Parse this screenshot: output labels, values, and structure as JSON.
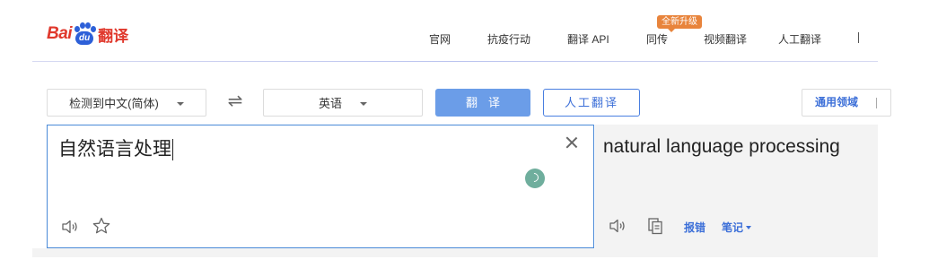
{
  "header": {
    "logo": {
      "bai": "Bai",
      "du": "du",
      "fanyi": "翻译"
    },
    "nav": [
      {
        "label": "官网"
      },
      {
        "label": "抗疫行动"
      },
      {
        "label": "翻译 API"
      },
      {
        "label": "同传"
      },
      {
        "label": "视频翻译"
      },
      {
        "label": "人工翻译"
      }
    ],
    "badge": "全新升级"
  },
  "toolbar": {
    "source_lang": "检测到中文(简体)",
    "target_lang": "英语",
    "translate_button": "翻译",
    "human_translate_button": "人工翻译",
    "domain_label": "通用领域"
  },
  "input": {
    "text": "自然语言处理"
  },
  "output": {
    "text": "natural language processing",
    "report_error": "报错",
    "notes": "笔记"
  },
  "colors": {
    "brand_red": "#e0382c",
    "brand_blue": "#2d60d8",
    "accent_blue": "#3c6fd8",
    "translate_button_bg": "#6b9de8",
    "badge_orange": "#e8843c"
  }
}
